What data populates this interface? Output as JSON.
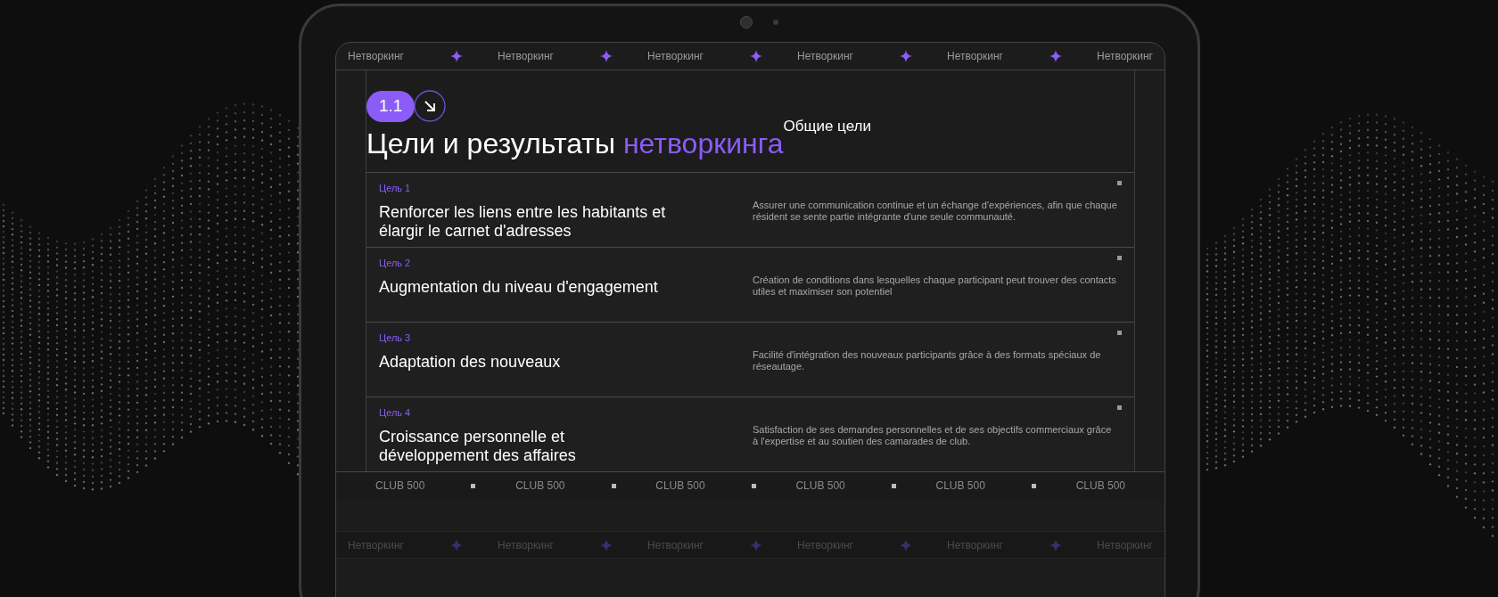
{
  "marquee_top": {
    "items": [
      "Нетворкинг",
      "Нетворкинг",
      "Нетворкинг",
      "Нетворкинг",
      "Нетворкинг",
      "Нетворкинг"
    ]
  },
  "section": {
    "number": "1.1",
    "title": "Цели и результаты",
    "title_accent": "нетворкинга",
    "subtitle": "Общие цели"
  },
  "goals": [
    {
      "label": "Цель 1",
      "title": "Renforcer les liens entre les habitants et élargir le carnet d'adresses",
      "description": "Assurer une communication continue et un échange d'expériences, afin que chaque résident se sente partie intégrante d'une seule communauté."
    },
    {
      "label": "Цель 2",
      "title": "Augmentation du niveau d'engagement",
      "description": "Création de conditions dans lesquelles chaque participant peut trouver des contacts utiles et maximiser son potentiel"
    },
    {
      "label": "Цель 3",
      "title": "Adaptation des nouveaux",
      "description": "Facilité d'intégration des nouveaux participants grâce à des formats spéciaux de réseautage."
    },
    {
      "label": "Цель 4",
      "title": "Croissance personnelle et développement des affaires",
      "description": "Satisfaction de ses demandes personnelles et de ses objectifs commerciaux grâce à l'expertise et au soutien des camarades de club."
    }
  ],
  "marquee_bottom": {
    "items": [
      "CLUB 500",
      "CLUB 500",
      "CLUB 500",
      "CLUB 500",
      "CLUB 500",
      "CLUB 500"
    ]
  },
  "reflection": {
    "items": [
      "Нетворкинг",
      "Нетворкинг",
      "Нетворкинг",
      "Нетворкинг",
      "Нетворкинг",
      "Нетворкинг"
    ]
  }
}
